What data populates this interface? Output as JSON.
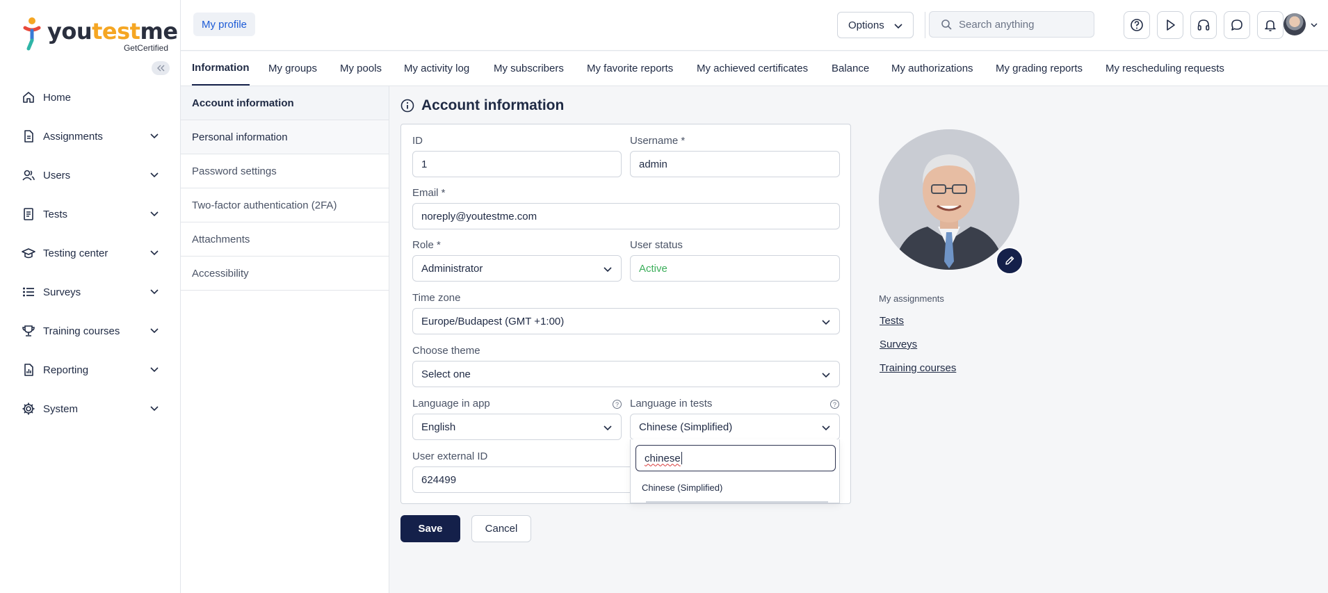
{
  "brand": {
    "you": "you",
    "test": "test",
    "me": "me",
    "sub": "GetCertified"
  },
  "sidebar": {
    "items": [
      {
        "label": "Home",
        "icon": "home-icon"
      },
      {
        "label": "Assignments",
        "icon": "document-icon"
      },
      {
        "label": "Users",
        "icon": "users-icon"
      },
      {
        "label": "Tests",
        "icon": "test-icon"
      },
      {
        "label": "Testing center",
        "icon": "graduation-cap-icon"
      },
      {
        "label": "Surveys",
        "icon": "list-icon"
      },
      {
        "label": "Training courses",
        "icon": "trophy-icon"
      },
      {
        "label": "Reporting",
        "icon": "report-icon"
      },
      {
        "label": "System",
        "icon": "gear-icon"
      }
    ]
  },
  "header": {
    "breadcrumb": "My profile",
    "options_label": "Options",
    "search_placeholder": "Search anything"
  },
  "tabs": [
    "Information",
    "My groups",
    "My pools",
    "My activity log",
    "My subscribers",
    "My favorite reports",
    "My achieved certificates",
    "Balance",
    "My authorizations",
    "My grading reports",
    "My rescheduling requests"
  ],
  "submenu": [
    "Account information",
    "Personal information",
    "Password settings",
    "Two-factor authentication (2FA)",
    "Attachments",
    "Accessibility"
  ],
  "form": {
    "title": "Account information",
    "id_label": "ID",
    "id_value": "1",
    "username_label": "Username *",
    "username_value": "admin",
    "email_label": "Email *",
    "email_value": "noreply@youtestme.com",
    "role_label": "Role *",
    "role_value": "Administrator",
    "status_label": "User status",
    "status_value": "Active",
    "timezone_label": "Time zone",
    "timezone_value": "Europe/Budapest (GMT +1:00)",
    "theme_label": "Choose theme",
    "theme_value": "Select one",
    "lang_app_label": "Language in app",
    "lang_app_value": "English",
    "lang_tests_label": "Language in tests",
    "lang_tests_value": "Chinese (Simplified)",
    "external_id_label": "User external ID",
    "external_id_value": "624499",
    "dropdown_filter": "chinese",
    "dropdown_option": "Chinese (Simplified)",
    "save_label": "Save",
    "cancel_label": "Cancel"
  },
  "assignments": {
    "title": "My assignments",
    "links": [
      "Tests",
      "Surveys",
      "Training courses"
    ]
  },
  "colors": {
    "accent": "#14204a",
    "link": "#1d5bd6",
    "active_status": "#3bae5a",
    "brand_orange": "#f5a623"
  }
}
